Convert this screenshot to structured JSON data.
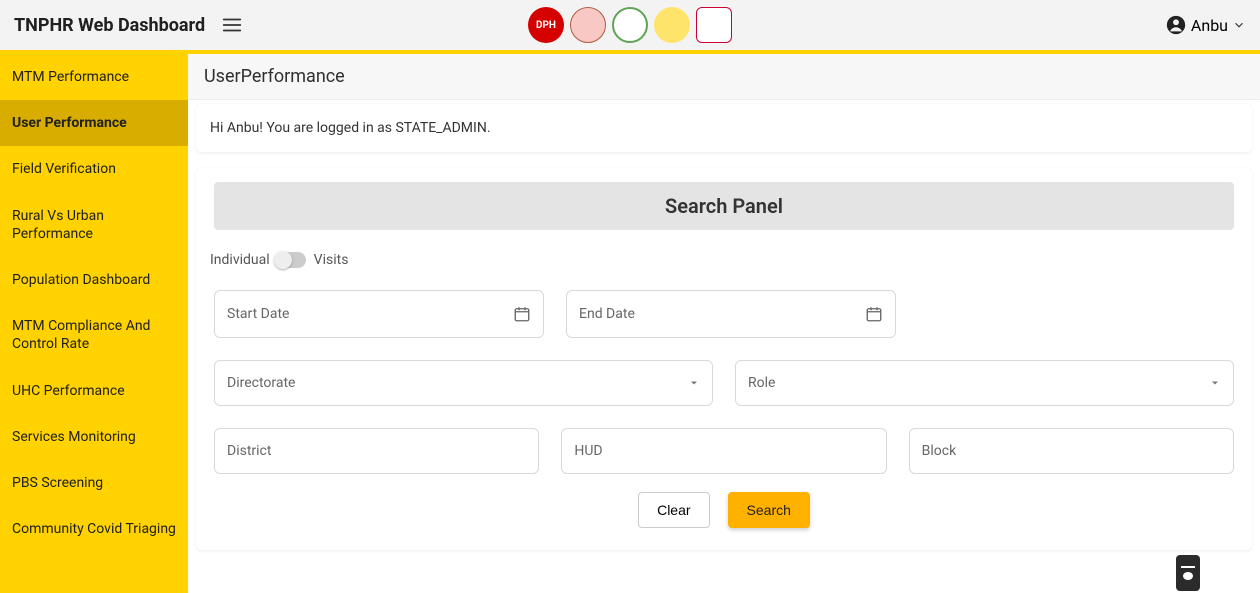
{
  "header": {
    "title": "TNPHR Web Dashboard",
    "user_label": "Anbu"
  },
  "sidebar": {
    "items": [
      {
        "label": "MTM Performance",
        "active": false
      },
      {
        "label": "User Performance",
        "active": true
      },
      {
        "label": "Field Verification",
        "active": false
      },
      {
        "label": "Rural Vs Urban Performance",
        "active": false
      },
      {
        "label": "Population Dashboard",
        "active": false
      },
      {
        "label": "MTM Compliance And Control Rate",
        "active": false
      },
      {
        "label": "UHC Performance",
        "active": false
      },
      {
        "label": "Services Monitoring",
        "active": false
      },
      {
        "label": "PBS Screening",
        "active": false
      },
      {
        "label": "Community Covid Triaging",
        "active": false
      }
    ]
  },
  "page": {
    "title": "UserPerformance",
    "greeting": "Hi Anbu! You are logged in as STATE_ADMIN."
  },
  "search_panel": {
    "header": "Search Panel",
    "toggle_left": "Individual",
    "toggle_right": "Visits",
    "fields": {
      "start_date": "Start Date",
      "end_date": "End Date",
      "directorate": "Directorate",
      "role": "Role",
      "district": "District",
      "hud": "HUD",
      "block": "Block"
    },
    "buttons": {
      "clear": "Clear",
      "search": "Search"
    }
  }
}
